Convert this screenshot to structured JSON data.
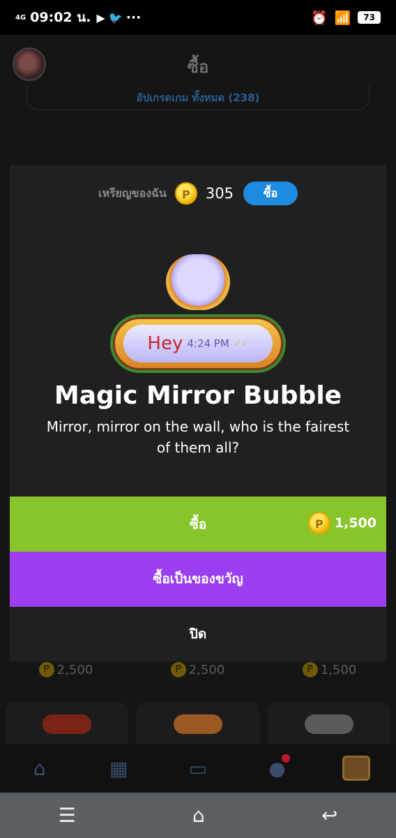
{
  "status_bar": {
    "network": "4G",
    "time": "09:02 น.",
    "app_icons": [
      "youtube-icon",
      "twitter-icon"
    ],
    "more": "···",
    "battery": "73"
  },
  "header": {
    "title": "ซื้อ",
    "upgrade_label": "อัปเกรดเกม ทั้งหมด (238)"
  },
  "background_prices": [
    "2,500",
    "2,500",
    "1,500"
  ],
  "coin_glyph": "P",
  "modal": {
    "wallet_label": "เหรียญของฉัน",
    "wallet_balance": "305",
    "top_buy_label": "ซื้อ",
    "preview": {
      "bubble_text": "Hey",
      "bubble_time": "4:24 PM",
      "bubble_check": "✓✓"
    },
    "item_title": "Magic Mirror Bubble",
    "item_description": "Mirror, mirror on the wall, who is the fairest of them all?",
    "buy_label": "ซื้อ",
    "buy_price": "1,500",
    "gift_label": "ซื้อเป็นของขวัญ",
    "close_label": "ปิด"
  },
  "bottom_nav": [
    "home-icon",
    "shop-icon",
    "chat-icon",
    "friends-icon",
    "chest-icon"
  ],
  "colors": {
    "buy_green": "#88c52b",
    "gift_purple": "#9b3ff0",
    "top_buy_blue": "#1f8be0",
    "coin_gold": "#f2b705"
  }
}
